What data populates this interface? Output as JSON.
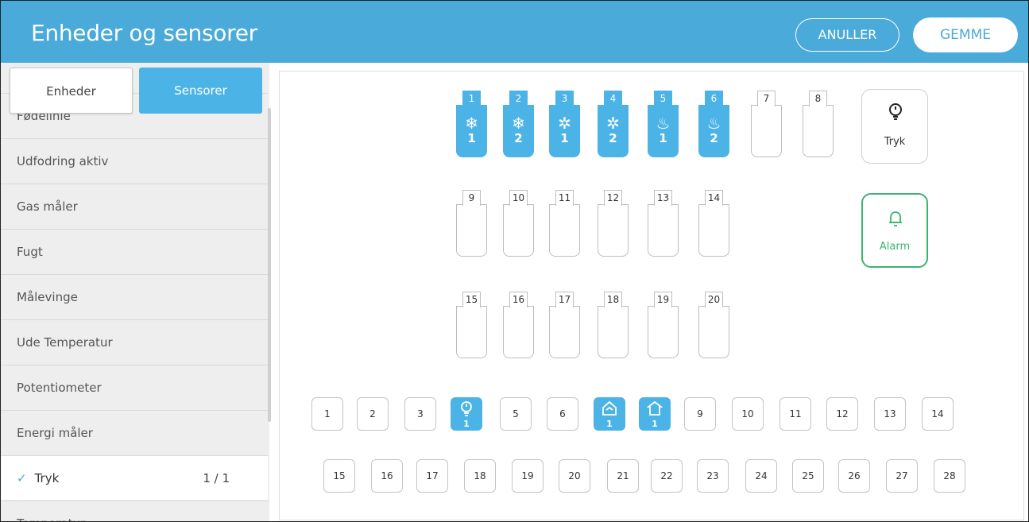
{
  "header": {
    "title": "Enheder og sensorer",
    "cancel_label": "ANULLER",
    "save_label": "GEMME"
  },
  "sidebar": {
    "tabs": {
      "units_label": "Enheder",
      "sensors_label": "Sensorer"
    },
    "items": [
      {
        "label": "Fødelinie",
        "count": ""
      },
      {
        "label": "Udfodring aktiv",
        "count": ""
      },
      {
        "label": "Gas måler",
        "count": ""
      },
      {
        "label": "Fugt",
        "count": ""
      },
      {
        "label": "Målevinge",
        "count": ""
      },
      {
        "label": "Ude Temperatur",
        "count": ""
      },
      {
        "label": "Potentiometer",
        "count": ""
      },
      {
        "label": "Energi måler",
        "count": ""
      },
      {
        "label": "Tryk",
        "count": "1 / 1",
        "check": "✓",
        "selected": true
      },
      {
        "label": "Temperatur",
        "count": ""
      }
    ]
  },
  "relay_slots": {
    "row1": [
      {
        "tab": "1",
        "icon": "snowflake-icon",
        "glyph": "❄",
        "num": "1"
      },
      {
        "tab": "2",
        "icon": "snowflake-icon",
        "glyph": "❄",
        "num": "2"
      },
      {
        "tab": "3",
        "icon": "fan-icon",
        "glyph": "✲",
        "num": "1"
      },
      {
        "tab": "4",
        "icon": "fan-icon",
        "glyph": "✲",
        "num": "2"
      },
      {
        "tab": "5",
        "icon": "heater-icon",
        "glyph": "♨",
        "num": "1"
      },
      {
        "tab": "6",
        "icon": "heater-icon",
        "glyph": "♨",
        "num": "2"
      },
      {
        "tab": "7"
      },
      {
        "tab": "8"
      }
    ],
    "row2": [
      "9",
      "10",
      "11",
      "12",
      "13",
      "14"
    ],
    "row3": [
      "15",
      "16",
      "17",
      "18",
      "19",
      "20"
    ]
  },
  "cards": {
    "pressure": {
      "label": "Tryk",
      "icon": "pressure-sensor-icon"
    },
    "alarm": {
      "label": "Alarm",
      "icon": "bell-icon",
      "color": "#3cb371"
    }
  },
  "analog_inputs": {
    "row1": [
      {
        "label": "1"
      },
      {
        "label": "2"
      },
      {
        "label": "3"
      },
      {
        "label": "",
        "icon": "pressure-sensor-icon",
        "num": "1"
      },
      {
        "label": "5"
      },
      {
        "label": "6"
      },
      {
        "label": "",
        "icon": "house-icon",
        "num": "1"
      },
      {
        "label": "",
        "icon": "curtain-icon",
        "num": "1"
      },
      {
        "label": "9"
      },
      {
        "label": "10"
      },
      {
        "label": "11"
      },
      {
        "label": "12"
      },
      {
        "label": "13"
      },
      {
        "label": "14"
      }
    ],
    "row2": [
      "15",
      "16",
      "17",
      "18",
      "19",
      "20",
      "21",
      "22",
      "23",
      "24",
      "25",
      "26",
      "27",
      "28"
    ]
  },
  "colors": {
    "header": "#4aaad9",
    "accent": "#4cb3e6",
    "alarm": "#3cb371"
  }
}
